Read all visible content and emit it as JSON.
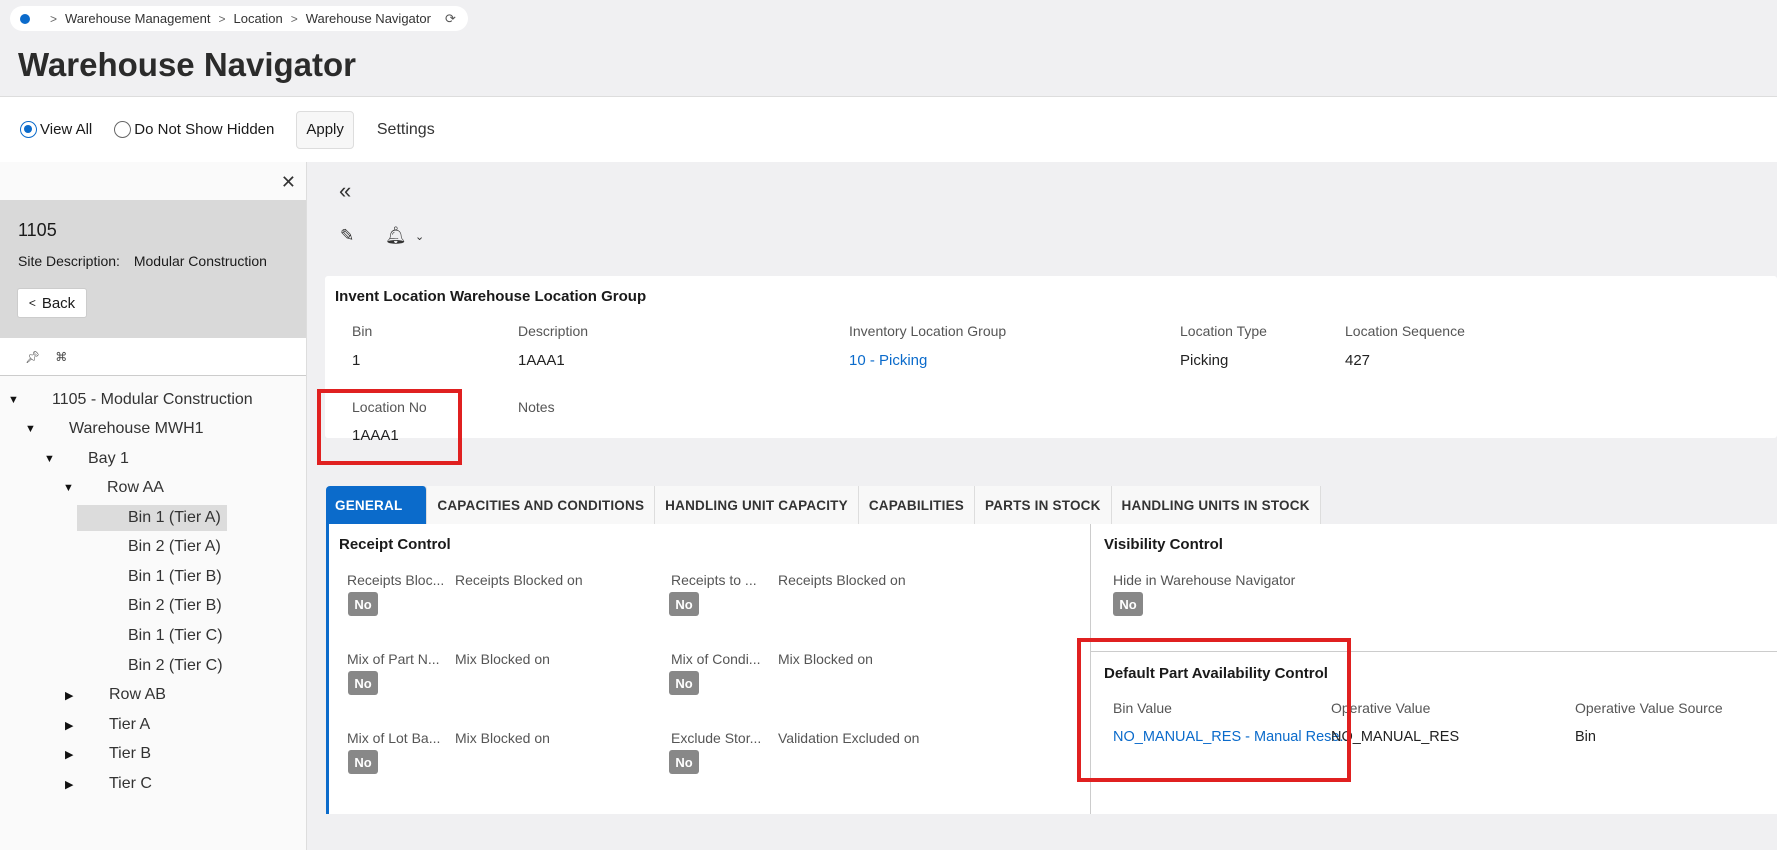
{
  "breadcrumb": {
    "items": [
      "Warehouse Management",
      "Location",
      "Warehouse Navigator"
    ]
  },
  "page": {
    "title": "Warehouse Navigator"
  },
  "toolbar": {
    "view_all": "View All",
    "do_not_show_hidden": "Do Not Show Hidden",
    "apply": "Apply",
    "settings": "Settings",
    "selected_option": "View All"
  },
  "site": {
    "id": "1105",
    "desc_label": "Site Description:",
    "desc_value": "Modular Construction",
    "back": "Back"
  },
  "tree": {
    "items": [
      {
        "label": "1105 - Modular Construction",
        "expanded": true
      },
      {
        "label": "Warehouse MWH1",
        "expanded": true
      },
      {
        "label": "Bay 1",
        "expanded": true
      },
      {
        "label": "Row AA",
        "expanded": true
      },
      {
        "label": "Bin 1 (Tier A)",
        "selected": true
      },
      {
        "label": "Bin 2 (Tier A)"
      },
      {
        "label": "Bin 1 (Tier B)"
      },
      {
        "label": "Bin 2 (Tier B)"
      },
      {
        "label": "Bin 1 (Tier C)"
      },
      {
        "label": "Bin 2 (Tier C)"
      },
      {
        "label": "Row AB",
        "expanded": false
      },
      {
        "label": "Tier A",
        "expanded": false
      },
      {
        "label": "Tier B",
        "expanded": false
      },
      {
        "label": "Tier C",
        "expanded": false
      }
    ]
  },
  "card": {
    "title": "Invent Location Warehouse Location Group",
    "fields": {
      "bin_label": "Bin",
      "bin_value": "1",
      "desc_label": "Description",
      "desc_value": "1AAA1",
      "group_label": "Inventory Location Group",
      "group_value": "10 - Picking",
      "type_label": "Location Type",
      "type_value": "Picking",
      "seq_label": "Location Sequence",
      "seq_value": "427",
      "locno_label": "Location No",
      "locno_value": "1AAA1",
      "notes_label": "Notes"
    }
  },
  "tabs": [
    "GENERAL",
    "CAPACITIES AND CONDITIONS",
    "HANDLING UNIT CAPACITY",
    "CAPABILITIES",
    "PARTS IN STOCK",
    "HANDLING UNITS IN STOCK"
  ],
  "general": {
    "receipt_title": "Receipt Control",
    "r1": [
      "Receipts Bloc...",
      "Receipts Blocked on",
      "Receipts to ...",
      "Receipts Blocked on"
    ],
    "r2": [
      "Mix of Part N...",
      "Mix Blocked on",
      "Mix of Condi...",
      "Mix Blocked on"
    ],
    "r3": [
      "Mix of Lot Ba...",
      "Mix Blocked on",
      "Exclude Stor...",
      "Validation Excluded on"
    ],
    "no": "No",
    "visibility_title": "Visibility Control",
    "hide_label": "Hide in Warehouse Navigator",
    "dpa_title": "Default Part Availability Control",
    "bin_value_label": "Bin Value",
    "bin_value": "NO_MANUAL_RES - Manual Rese...",
    "op_value_label": "Operative Value",
    "op_value": "NO_MANUAL_RES",
    "op_source_label": "Operative Value Source",
    "op_source": "Bin"
  },
  "colors": {
    "accent": "#0b6bcb",
    "highlight": "#e02020",
    "badge": "#888888"
  }
}
